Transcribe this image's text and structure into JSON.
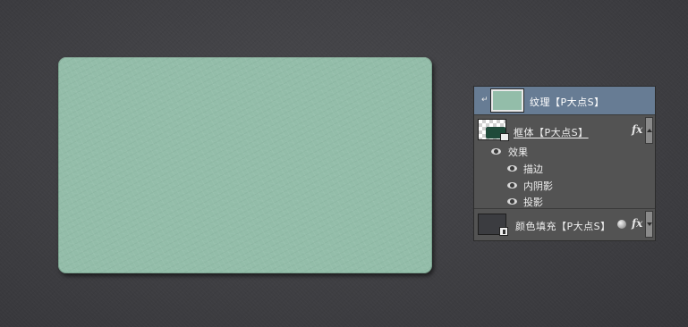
{
  "canvas": {
    "card_color": "#93bda9",
    "background_color": "#434347"
  },
  "layers_panel": {
    "selected_color": "#677c94",
    "layers": [
      {
        "id": "texture",
        "name": "纹理【P大点S】",
        "selected": true,
        "clipped": true,
        "clip_indicator": "↵"
      },
      {
        "id": "frame",
        "name": "框体【P大点S】",
        "fx_label": "fx",
        "effects_header": "效果",
        "effects": [
          {
            "name": "描边"
          },
          {
            "name": "内阴影"
          },
          {
            "name": "投影"
          }
        ]
      },
      {
        "id": "color-fill",
        "name": "颜色填充【P大点S】",
        "fx_label": "fx"
      }
    ]
  }
}
